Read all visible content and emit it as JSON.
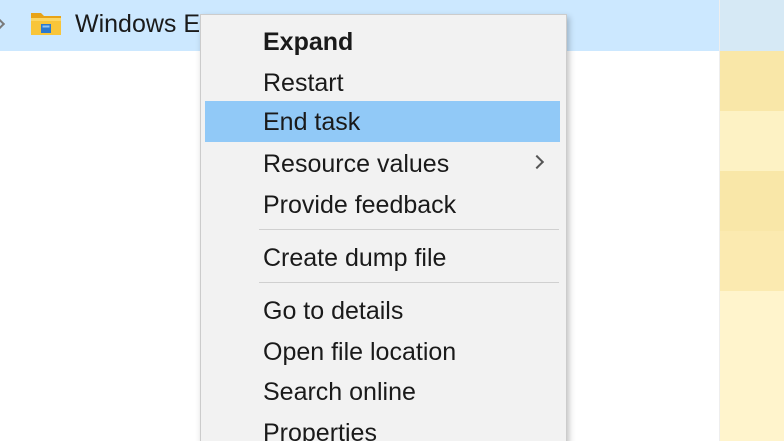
{
  "process_row": {
    "name": "Windows E"
  },
  "context_menu": {
    "items": [
      {
        "label": "Expand"
      },
      {
        "label": "Restart"
      },
      {
        "label": "End task"
      },
      {
        "label": "Resource values"
      },
      {
        "label": "Provide feedback"
      },
      {
        "label": "Create dump file"
      },
      {
        "label": "Go to details"
      },
      {
        "label": "Open file location"
      },
      {
        "label": "Search online"
      },
      {
        "label": "Properties"
      }
    ]
  },
  "colors": {
    "selected_row": "#cce8ff",
    "menu_background": "#f2f2f2",
    "menu_highlight": "#91c9f7",
    "value_heat_1": "#f9e7a8",
    "value_heat_2": "#fdf2c4",
    "value_heat_3": "#fff4cc"
  },
  "icons": {
    "process": "file-explorer-folder-icon",
    "row_toggle": "chevron-right-icon",
    "submenu": "chevron-right-icon"
  }
}
